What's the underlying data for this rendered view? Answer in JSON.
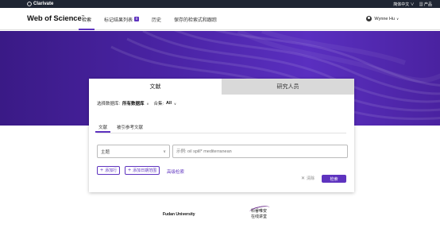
{
  "topbar": {
    "brand": "Clarivate",
    "language": "简体中文 ∨",
    "products": "产品"
  },
  "nav": {
    "logo": "Web of Science",
    "logo_mark": "™",
    "tabs": [
      {
        "label": "检索"
      },
      {
        "label": "标记结果列表"
      },
      {
        "label": "历史"
      },
      {
        "label": "保存的检索式和跟踪"
      }
    ],
    "badge": "0",
    "user": "Wynne Hu"
  },
  "card": {
    "tabs": [
      "文献",
      "研究人员"
    ],
    "db_label": "选择数据库:",
    "db_value": "所有数据库",
    "collection_label": "合集:",
    "collection_value": "All",
    "subtabs": [
      "文献",
      "被引参考文献"
    ],
    "field_value": "主题",
    "query_placeholder": "示例: oil spill* mediterranean",
    "add_row": "添加行",
    "add_date": "添加日期范围",
    "advanced": "高级检索",
    "clear": "清除",
    "search": "检索"
  },
  "footer": {
    "institution": "Fudan University",
    "logo_text": "科睿唯安 在线讲堂"
  },
  "colors": {
    "accent": "#5e33bf",
    "hero": "#4b24a6",
    "topbar": "#1f2633"
  }
}
